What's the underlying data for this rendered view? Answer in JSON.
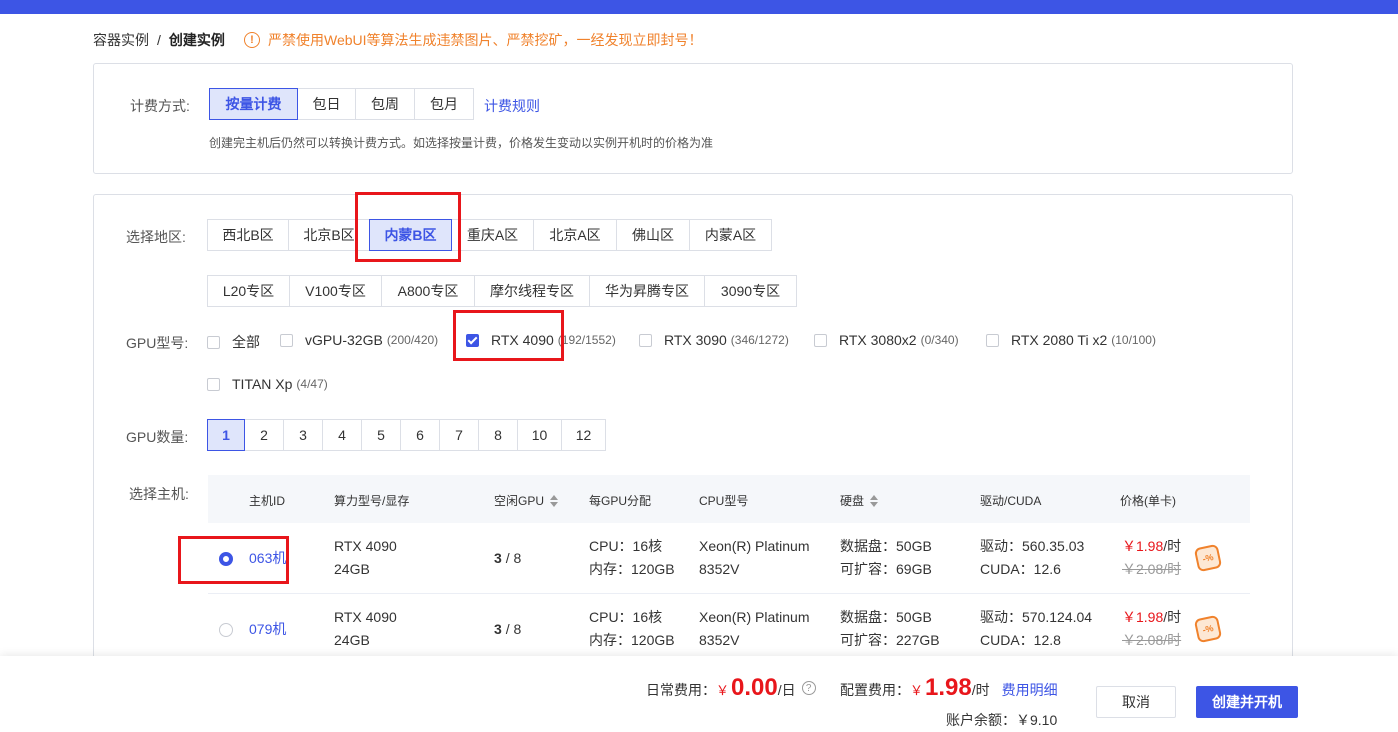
{
  "breadcrumb": {
    "parent": "容器实例",
    "separator": "/",
    "current": "创建实例"
  },
  "warning": {
    "icon": "!",
    "text": "严禁使用WebUI等算法生成违禁图片、严禁挖矿，一经发现立即封号！"
  },
  "billing": {
    "label": "计费方式:",
    "options": [
      "按量计费",
      "包日",
      "包周",
      "包月"
    ],
    "selected": "按量计费",
    "rules_link": "计费规则",
    "note": "创建完主机后仍然可以转换计费方式。如选择按量计费，价格发生变动以实例开机时的价格为准"
  },
  "region": {
    "label": "选择地区:",
    "row1": [
      "西北B区",
      "北京B区",
      "内蒙B区",
      "重庆A区",
      "北京A区",
      "佛山区",
      "内蒙A区"
    ],
    "row2": [
      "L20专区",
      "V100专区",
      "A800专区",
      "摩尔线程专区",
      "华为昇腾专区",
      "3090专区"
    ],
    "selected": "内蒙B区"
  },
  "gpu_model": {
    "label": "GPU型号:",
    "options": [
      {
        "name": "全部",
        "count": "",
        "checked": false
      },
      {
        "name": "vGPU-32GB",
        "count": "(200/420)",
        "checked": false
      },
      {
        "name": "RTX 4090",
        "count": "(192/1552)",
        "checked": true
      },
      {
        "name": "RTX 3090",
        "count": "(346/1272)",
        "checked": false
      },
      {
        "name": "RTX 3080x2",
        "count": "(0/340)",
        "checked": false
      },
      {
        "name": "RTX 2080 Ti x2",
        "count": "(10/100)",
        "checked": false
      },
      {
        "name": "TITAN Xp",
        "count": "(4/47)",
        "checked": false
      }
    ]
  },
  "gpu_count": {
    "label": "GPU数量:",
    "options": [
      "1",
      "2",
      "3",
      "4",
      "5",
      "6",
      "7",
      "8",
      "10",
      "12"
    ],
    "selected": "1"
  },
  "host": {
    "label": "选择主机:",
    "columns": [
      "主机ID",
      "算力型号/显存",
      "空闲GPU",
      "每GPU分配",
      "CPU型号",
      "硬盘",
      "驱动/CUDA",
      "价格(单卡)"
    ],
    "rows": [
      {
        "selected": true,
        "id": "063机",
        "model": "RTX 4090",
        "vram": "24GB",
        "free": "3",
        "total": "/ 8",
        "cpu_alloc": "CPU：16核",
        "mem_alloc": "内存：120GB",
        "cpu_model": "Xeon(R) Platinum",
        "cpu_model2": "8352V",
        "disk": "数据盘：50GB",
        "disk_ext": "可扩容：69GB",
        "driver": "驱动：560.35.03",
        "cuda": "CUDA：12.6",
        "price": "￥1.98",
        "price_unit": "/时",
        "old_price": "￥2.08/时"
      },
      {
        "selected": false,
        "id": "079机",
        "model": "RTX 4090",
        "vram": "24GB",
        "free": "3",
        "total": "/ 8",
        "cpu_alloc": "CPU：16核",
        "mem_alloc": "内存：120GB",
        "cpu_model": "Xeon(R) Platinum",
        "cpu_model2": "8352V",
        "disk": "数据盘：50GB",
        "disk_ext": "可扩容：227GB",
        "driver": "驱动：570.124.04",
        "cuda": "CUDA：12.8",
        "price": "￥1.98",
        "price_unit": "/时",
        "old_price": "￥2.08/时"
      }
    ],
    "discount_badge": "-%"
  },
  "footer": {
    "daily_label": "日常费用：",
    "daily_currency": "￥",
    "daily_value": "0.00",
    "daily_unit": "/日",
    "help_icon": "?",
    "config_label": "配置费用：",
    "config_currency": "￥",
    "config_value": "1.98",
    "config_unit": "/时",
    "detail_link": "费用明细",
    "balance": "账户余额：￥9.10",
    "cancel": "取消",
    "create": "创建并开机"
  },
  "colors": {
    "primary": "#3d55e5",
    "price_red": "#e8161b",
    "warning": "#f0822c",
    "highlight_box": "#e8161b"
  }
}
